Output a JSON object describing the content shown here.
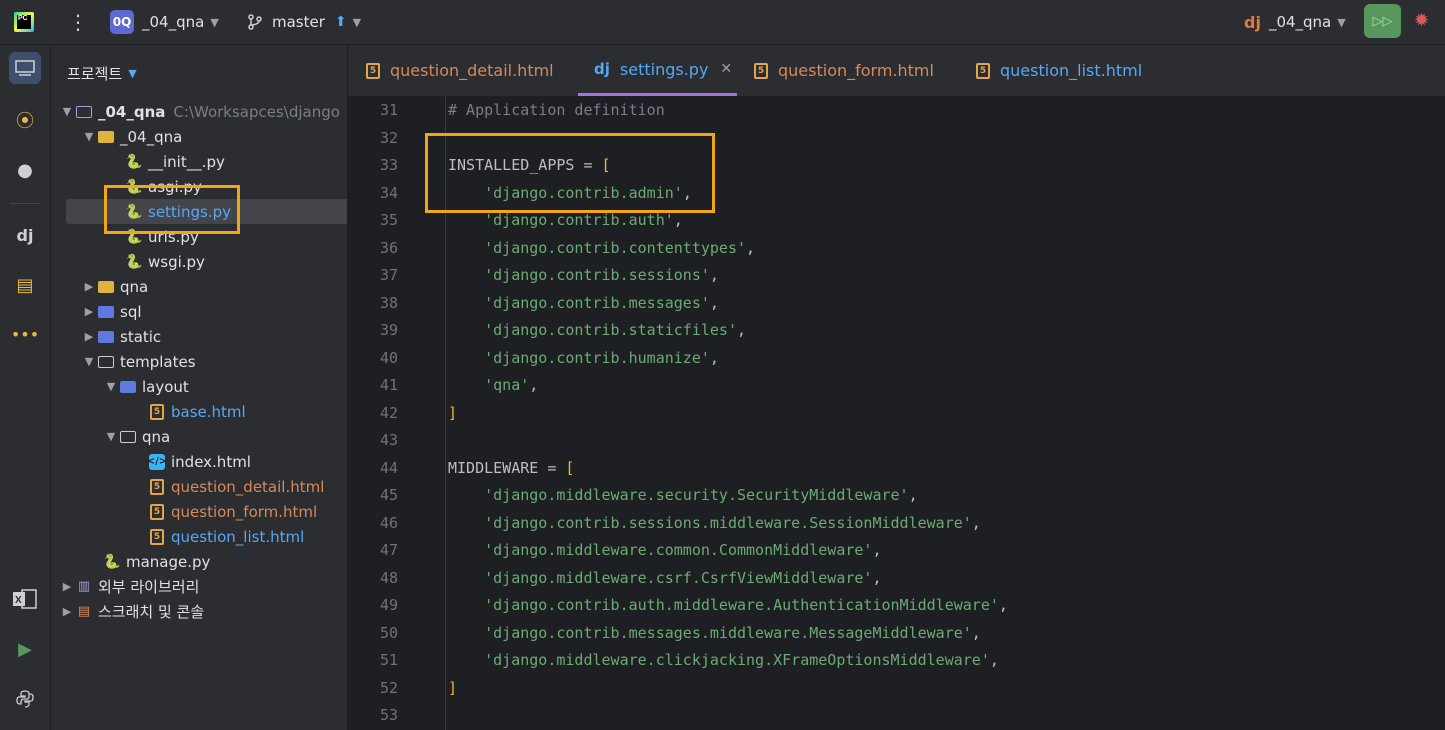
{
  "topbar": {
    "project_badge": "0Q",
    "project_name": "_04_qna",
    "branch": "master",
    "run_config": "_04_qna",
    "icons": [
      "pycharm-logo",
      "kebab-menu-icon",
      "branch-icon",
      "push-arrow-icon",
      "django-icon",
      "run-icon",
      "debug-icon"
    ]
  },
  "sidebar": {
    "header": "프로젝트",
    "tree": [
      {
        "label": "_04_qna",
        "path": "C:\\Worksapces\\django",
        "depth": 0,
        "expanded": true,
        "kind": "root-folder"
      },
      {
        "label": "_04_qna",
        "depth": 1,
        "expanded": true,
        "kind": "folder-yellow"
      },
      {
        "label": "__init__.py",
        "depth": 2,
        "kind": "python"
      },
      {
        "label": "asgi.py",
        "depth": 2,
        "kind": "python"
      },
      {
        "label": "settings.py",
        "depth": 2,
        "kind": "python",
        "selected": true
      },
      {
        "label": "urls.py",
        "depth": 2,
        "kind": "python"
      },
      {
        "label": "wsgi.py",
        "depth": 2,
        "kind": "python"
      },
      {
        "label": "qna",
        "depth": 1,
        "expanded": false,
        "kind": "folder-yellow"
      },
      {
        "label": "sql",
        "depth": 1,
        "expanded": false,
        "kind": "folder-sql"
      },
      {
        "label": "static",
        "depth": 1,
        "expanded": false,
        "kind": "folder-static"
      },
      {
        "label": "templates",
        "depth": 1,
        "expanded": true,
        "kind": "folder-templates"
      },
      {
        "label": "layout",
        "depth": 2,
        "expanded": true,
        "kind": "folder-blue"
      },
      {
        "label": "base.html",
        "depth": 3,
        "kind": "html"
      },
      {
        "label": "qna",
        "depth": 2,
        "expanded": true,
        "kind": "folder-outline"
      },
      {
        "label": "index.html",
        "depth": 3,
        "kind": "html-index"
      },
      {
        "label": "question_detail.html",
        "depth": 3,
        "kind": "html-modified"
      },
      {
        "label": "question_form.html",
        "depth": 3,
        "kind": "html-modified"
      },
      {
        "label": "question_list.html",
        "depth": 3,
        "kind": "html"
      },
      {
        "label": "manage.py",
        "depth": 1,
        "kind": "python"
      },
      {
        "label": "외부 라이브러리",
        "depth": 0,
        "expanded": false,
        "kind": "library"
      },
      {
        "label": "스크래치 및 콘솔",
        "depth": 0,
        "expanded": false,
        "kind": "scratch"
      }
    ]
  },
  "tabs": [
    {
      "label": "question_detail.html",
      "kind": "html",
      "modified": true
    },
    {
      "label": "settings.py",
      "kind": "django",
      "active": true
    },
    {
      "label": "question_form.html",
      "kind": "html",
      "modified": true
    },
    {
      "label": "question_list.html",
      "kind": "html"
    }
  ],
  "editor": {
    "lines": [
      {
        "n": "31",
        "text": "# Application definition"
      },
      {
        "n": "32",
        "text": ""
      },
      {
        "n": "33",
        "text": "INSTALLED_APPS = ["
      },
      {
        "n": "34",
        "text": "    'django.contrib.admin',"
      },
      {
        "n": "35",
        "text": "    'django.contrib.auth',"
      },
      {
        "n": "36",
        "text": "    'django.contrib.contenttypes',"
      },
      {
        "n": "37",
        "text": "    'django.contrib.sessions',"
      },
      {
        "n": "38",
        "text": "    'django.contrib.messages',"
      },
      {
        "n": "39",
        "text": "    'django.contrib.staticfiles',"
      },
      {
        "n": "40",
        "text": "    'django.contrib.humanize',"
      },
      {
        "n": "41",
        "text": "    'qna',"
      },
      {
        "n": "42",
        "text": "]"
      },
      {
        "n": "43",
        "text": ""
      },
      {
        "n": "44",
        "text": "MIDDLEWARE = ["
      },
      {
        "n": "45",
        "text": "    'django.middleware.security.SecurityMiddleware',"
      },
      {
        "n": "46",
        "text": "    'django.contrib.sessions.middleware.SessionMiddleware',"
      },
      {
        "n": "47",
        "text": "    'django.middleware.common.CommonMiddleware',"
      },
      {
        "n": "48",
        "text": "    'django.middleware.csrf.CsrfViewMiddleware',"
      },
      {
        "n": "49",
        "text": "    'django.contrib.auth.middleware.AuthenticationMiddleware',"
      },
      {
        "n": "50",
        "text": "    'django.contrib.messages.middleware.MessageMiddleware',"
      },
      {
        "n": "51",
        "text": "    'django.middleware.clickjacking.XFrameOptionsMiddleware',"
      },
      {
        "n": "52",
        "text": "]"
      },
      {
        "n": "53",
        "text": ""
      }
    ]
  },
  "colors": {
    "highlight_box": "#f2a516",
    "tab_active_underline": "#a571e6",
    "string": "#6aab73",
    "bracket": "#e8ba36",
    "comment": "#7a7e85",
    "run_button": "#57965c"
  }
}
